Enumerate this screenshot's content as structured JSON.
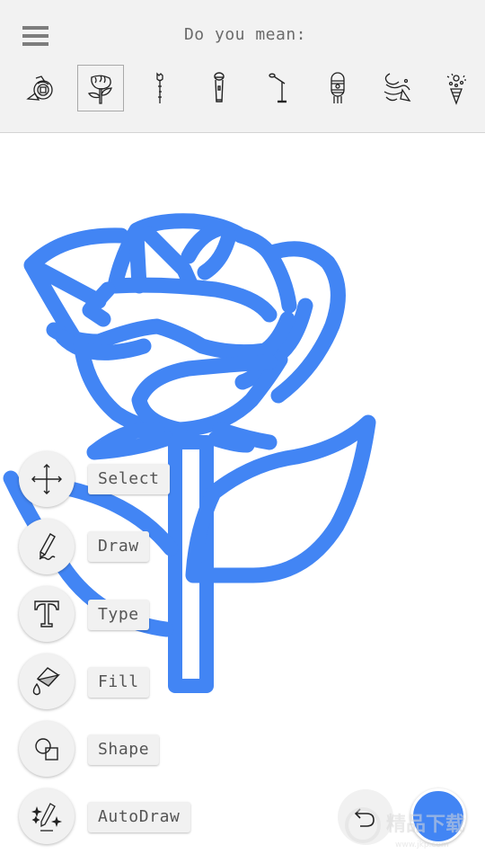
{
  "header": {
    "menu_icon": "hamburger-icon",
    "prompt": "Do you mean:"
  },
  "suggestions": [
    {
      "name": "rose-bloom",
      "selected": false
    },
    {
      "name": "rose-with-leaves",
      "selected": true
    },
    {
      "name": "rose-long-stem",
      "selected": false
    },
    {
      "name": "microphone",
      "selected": false
    },
    {
      "name": "microphone-stand",
      "selected": false
    },
    {
      "name": "vintage-microphone",
      "selected": false
    },
    {
      "name": "party-streamers",
      "selected": false
    },
    {
      "name": "party-popper",
      "selected": false
    }
  ],
  "tools": [
    {
      "id": "select",
      "label": "Select",
      "icon": "move-arrows-icon"
    },
    {
      "id": "draw",
      "label": "Draw",
      "icon": "pencil-icon"
    },
    {
      "id": "type",
      "label": "Type",
      "icon": "text-t-icon"
    },
    {
      "id": "fill",
      "label": "Fill",
      "icon": "paint-bucket-icon"
    },
    {
      "id": "shape",
      "label": "Shape",
      "icon": "shapes-icon"
    },
    {
      "id": "autodraw",
      "label": "AutoDraw",
      "icon": "magic-pencil-icon"
    }
  ],
  "actions": {
    "undo_icon": "undo-icon",
    "current_color": "#4285f4"
  },
  "drawing": {
    "subject": "rose",
    "stroke_color": "#4285f4"
  },
  "watermark": {
    "text": "精品下载",
    "subtext": "www.jkp.com"
  }
}
